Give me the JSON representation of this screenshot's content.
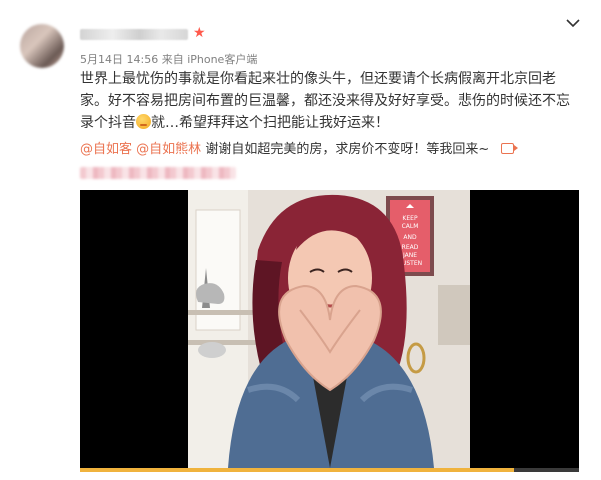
{
  "post": {
    "date": "5月14日 14:56",
    "source": "来自 iPhone客户端",
    "text": "世界上最忧伤的事就是你看起来壮的像头牛，但还要请个长病假离开北京回老家。好不容易把房间布置的巨温馨，都还没来得及好好享受。悲伤的时候还不忘录个抖音",
    "text_after_emoji": "就…希望拜拜这个扫把能让我好运来！",
    "mentions": [
      "@自如客",
      "@自如熊林"
    ],
    "mention_followup": "谢谢自如超完美的房，求房价不变呀！等我回来~",
    "sad_emoji_icon": "sad-face-emoji",
    "vip_icon": "star-badge",
    "poster_text": [
      "KEEP",
      "CALM",
      "AND",
      "READ",
      "JANE",
      "AUSTEN"
    ]
  },
  "video": {
    "progress": 0.87
  },
  "colors": {
    "accent": "#eb7350",
    "video_background": "#000000",
    "progress": "#f0b33d"
  }
}
